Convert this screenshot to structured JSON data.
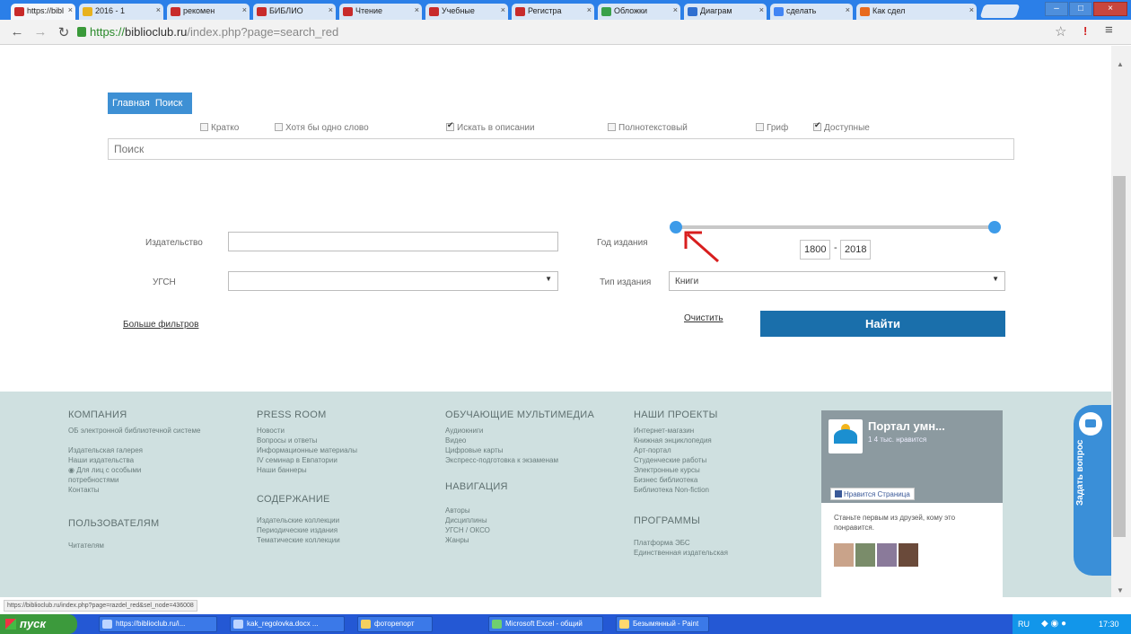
{
  "browser": {
    "tabs": [
      {
        "label": "https://bibl"
      },
      {
        "label": "2016 - 1"
      },
      {
        "label": "рекомен"
      },
      {
        "label": "БИБЛИО"
      },
      {
        "label": "Чтение"
      },
      {
        "label": "Учебные"
      },
      {
        "label": "Регистра"
      },
      {
        "label": "Обложки"
      },
      {
        "label": "Диаграм"
      },
      {
        "label": "сделать"
      },
      {
        "label": "Как сдел"
      }
    ],
    "address": {
      "scheme": "https://",
      "host": "biblioclub.ru",
      "path": "/index.php?page=search_red"
    },
    "window_buttons": {
      "minimize": "–",
      "maximize": "□",
      "close": "×"
    }
  },
  "search_form": {
    "tabs": [
      "Главная",
      "Поиск"
    ],
    "options": [
      {
        "label": "Кратко",
        "checked": false
      },
      {
        "label": "Хотя бы одно слово",
        "checked": false
      },
      {
        "label": "Искать в описании",
        "checked": true
      },
      {
        "label": "Полнотекстовый",
        "checked": false
      },
      {
        "label": "Гриф",
        "checked": false
      },
      {
        "label": "Доступные",
        "checked": true
      }
    ],
    "search_placeholder": "Поиск",
    "publisher_label": "Издательство",
    "udc_label": "УГСН",
    "year_label": "Год издания",
    "year_from": "1800",
    "year_to": "2018",
    "year_dash": "-",
    "edition_type_label": "Тип издания",
    "edition_type_value": "Книги",
    "more_filters": "Больше фильтров",
    "clear": "Очистить",
    "find": "Найти"
  },
  "footer": {
    "company": {
      "title": "КОМПАНИЯ",
      "links": [
        "ОБ электронной библиотечной системе",
        "Издательская галерея",
        "Наши издательства",
        "Для лиц с особыми потребностями",
        "Контакты"
      ]
    },
    "users": {
      "title": "ПОЛЬЗОВАТЕЛЯМ",
      "links": [
        "Читателям"
      ]
    },
    "press": {
      "title": "PRESS ROOM",
      "links": [
        "Новости",
        "Вопросы и ответы",
        "Информационные материалы",
        "IV семинар в Евпатории",
        "Наши баннеры"
      ]
    },
    "content": {
      "title": "СОДЕРЖАНИЕ",
      "links": [
        "Издательские коллекции",
        "Периодические издания",
        "Тематические коллекции"
      ]
    },
    "multimedia": {
      "title": "ОБУЧАЮЩИЕ МУЛЬТИМЕДИА",
      "links": [
        "Аудиокниги",
        "Видео",
        "Цифровые карты",
        "Экспресс-подготовка к экзаменам"
      ]
    },
    "navigation": {
      "title": "НАВИГАЦИЯ",
      "links": [
        "Авторы",
        "Дисциплины",
        "УГСН / ОКСО",
        "Жанры"
      ]
    },
    "projects": {
      "title": "НАШИ ПРОЕКТЫ",
      "links": [
        "Интернет-магазин",
        "Книжная энциклопедия",
        "Арт-портал",
        "Студенческие работы",
        "Электронные курсы",
        "Бизнес библиотека",
        "Библиотека Non-fiction"
      ]
    },
    "programs": {
      "title": "ПРОГРАММЫ",
      "links": [
        "Платформа ЭБС",
        "Единственная издательская"
      ]
    }
  },
  "facebook_widget": {
    "page_name": "Портал умн...",
    "likes": "1 4 тыс. нравится",
    "like_button": "Нравится Страница",
    "friends_text": "Станьте первым из друзей, кому это понравится."
  },
  "ask_question": "Задать вопрос",
  "status_url": "https://biblioclub.ru/index.php?page=razdel_red&sel_node=436008",
  "taskbar": {
    "start": "пуск",
    "tasks": [
      "https://biblioclub.ru/i...",
      "kak_regolovka.docx ...",
      "фоторепорт",
      "Microsoft Excel - общий",
      "Безымянный - Paint"
    ],
    "lang": "RU",
    "clock": "17:30"
  },
  "colors": {
    "accent": "#1a6fab",
    "pill": "#3e90d4",
    "footer_bg": "#cfe0e0",
    "slider": "#3d9be9",
    "taskbar": "#2458d4"
  }
}
